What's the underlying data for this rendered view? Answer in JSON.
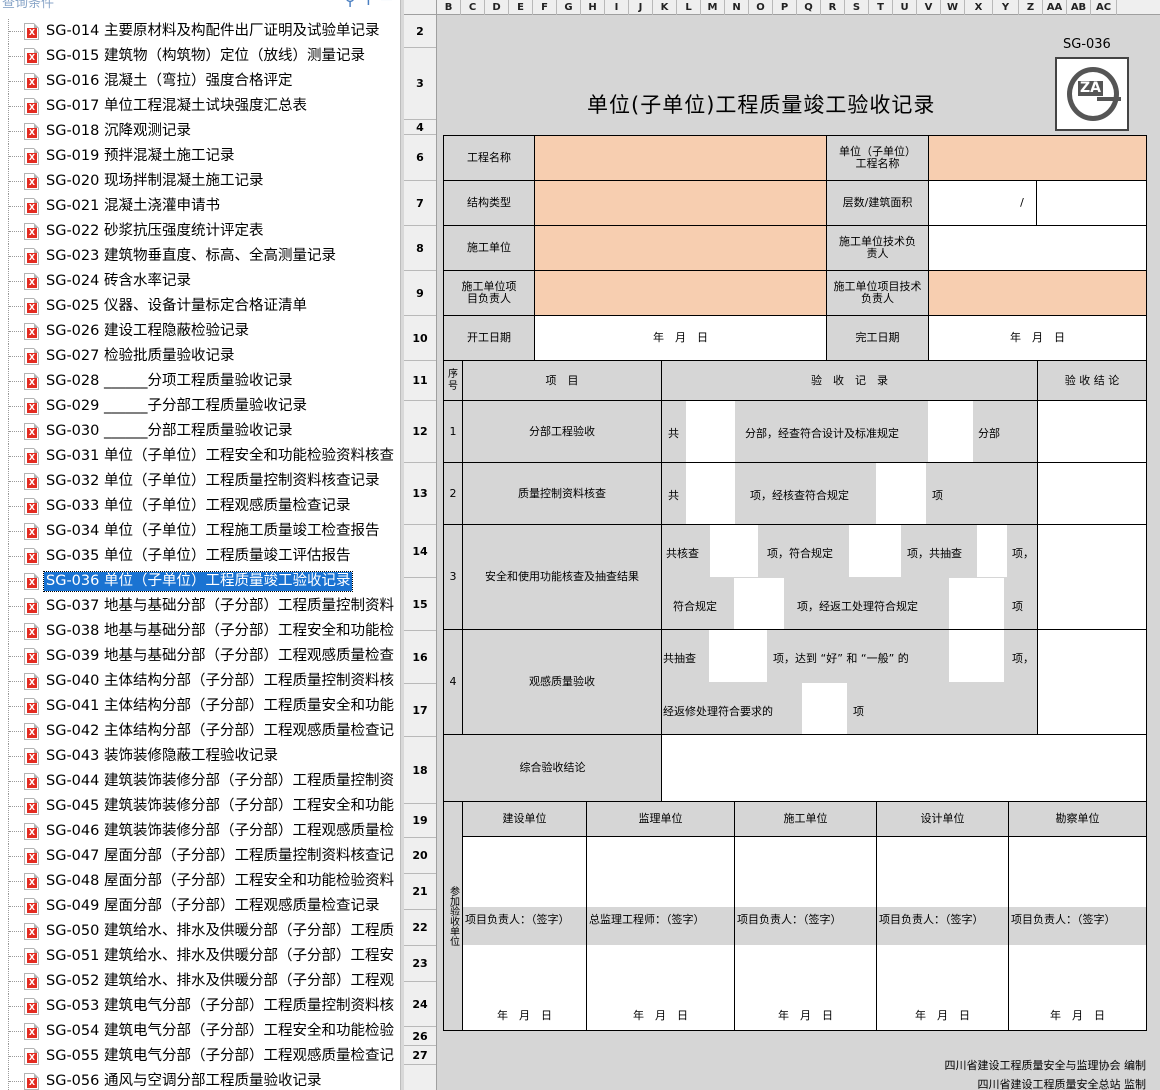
{
  "tree": {
    "search_text": "查询条件",
    "items": [
      "SG-014 主要原材料及构配件出厂证明及试验单记录",
      "SG-015 建筑物（构筑物）定位（放线）测量记录",
      "SG-016 混凝土（弯拉）强度合格评定",
      "SG-017 单位工程混凝土试块强度汇总表",
      "SG-018 沉降观测记录",
      "SG-019 预拌混凝土施工记录",
      "SG-020 现场拌制混凝土施工记录",
      "SG-021 混凝土浇灌申请书",
      "SG-022 砂浆抗压强度统计评定表",
      "SG-023 建筑物垂直度、标高、全高测量记录",
      "SG-024 砖含水率记录",
      "SG-025 仪器、设备计量标定合格证清单",
      "SG-026 建设工程隐蔽检验记录",
      "SG-027 检验批质量验收记录",
      "SG-028 ______分项工程质量验收记录",
      "SG-029 ______子分部工程质量验收记录",
      "SG-030 ______分部工程质量验收记录",
      "SG-031 单位（子单位）工程安全和功能检验资料核查",
      "SG-032 单位（子单位）工程质量控制资料核查记录",
      "SG-033 单位（子单位）工程观感质量检查记录",
      "SG-034 单位（子单位）工程施工质量竣工检查报告",
      "SG-035 单位（子单位）工程质量竣工评估报告",
      "SG-036 单位（子单位）工程质量竣工验收记录",
      "SG-037 地基与基础分部（子分部）工程质量控制资料",
      "SG-038 地基与基础分部（子分部）工程安全和功能检",
      "SG-039 地基与基础分部（子分部）工程观感质量检查",
      "SG-040 主体结构分部（子分部）工程质量控制资料核",
      "SG-041 主体结构分部（子分部）工程质量安全和功能",
      "SG-042 主体结构分部（子分部）工程观感质量检查记",
      "SG-043 装饰装修隐蔽工程验收记录",
      "SG-044 建筑装饰装修分部（子分部）工程质量控制资",
      "SG-045 建筑装饰装修分部（子分部）工程安全和功能",
      "SG-046 建筑装饰装修分部（子分部）工程观感质量检",
      "SG-047 屋面分部（子分部）工程质量控制资料核查记",
      "SG-048 屋面分部（子分部）工程安全和功能检验资料",
      "SG-049 屋面分部（子分部）工程观感质量检查记录",
      "SG-050 建筑给水、排水及供暖分部（子分部）工程质",
      "SG-051 建筑给水、排水及供暖分部（子分部）工程安",
      "SG-052 建筑给水、排水及供暖分部（子分部）工程观",
      "SG-053 建筑电气分部（子分部）工程质量控制资料核",
      "SG-054 建筑电气分部（子分部）工程安全和功能检验",
      "SG-055 建筑电气分部（子分部）工程观感质量检查记",
      "SG-056 通风与空调分部工程质量验收记录"
    ],
    "selected_index": 22
  },
  "sheet": {
    "columns": [
      "B",
      "C",
      "D",
      "E",
      "F",
      "G",
      "H",
      "I",
      "J",
      "K",
      "L",
      "M",
      "N",
      "O",
      "P",
      "Q",
      "R",
      "S",
      "T",
      "U",
      "V",
      "W",
      "X",
      "Y",
      "Z",
      "AA",
      "AB",
      "AC"
    ],
    "rows": [
      "2",
      "3",
      "4",
      "6",
      "7",
      "8",
      "9",
      "10",
      "11",
      "12",
      "13",
      "14",
      "15",
      "16",
      "17",
      "18",
      "19",
      "20",
      "21",
      "22",
      "23",
      "24",
      "26",
      "27"
    ],
    "code": "SG-036",
    "title": "单位(子单位)工程质量竣工验收记录",
    "logo_text": "ZA",
    "labels": {
      "project_name": "工程名称",
      "unit_project_name": "单位（子单位）工程名称",
      "structure_type": "结构类型",
      "floors_area": "层数/建筑面积",
      "slash": "/",
      "contractor": "施工单位",
      "contractor_tech": "施工单位技术负责人",
      "contractor_pm": "施工单位项目负责人",
      "contractor_pm_tech": "施工单位项目技术负责人",
      "start_date": "开工日期",
      "finish_date": "完工日期",
      "date": "年　月　日",
      "seq": "序号",
      "item": "项　目",
      "record": "验　收　记　录",
      "conclusion": "验 收 结 论"
    },
    "items": [
      {
        "no": "1",
        "name": "分部工程验收",
        "a": "共",
        "b": "分部，经查符合设计及标准规定",
        "c": "分部"
      },
      {
        "no": "2",
        "name": "质量控制资料核查",
        "a": "共",
        "b": "项，经核查符合规定",
        "c": "项"
      },
      {
        "no": "3",
        "name": "安全和使用功能核查及抽查结果",
        "a": "共核查",
        "b": "项，符合规定",
        "c": "项，共抽查",
        "d": "项，",
        "e": "符合规定",
        "f": "项，经返工处理符合规定",
        "g": "项"
      },
      {
        "no": "4",
        "name": "观感质量验收",
        "a": "共抽查",
        "b": "项，达到 “好” 和 “一般” 的",
        "c": "项，",
        "d": "经返修处理符合要求的",
        "e": "项"
      }
    ],
    "overall": "综合验收结论",
    "participants_label": "参加验收单位",
    "units": [
      {
        "name": "建设单位",
        "sign": "项目负责人：（签字）"
      },
      {
        "name": "监理单位",
        "sign": "总监理工程师：（签字）"
      },
      {
        "name": "施工单位",
        "sign": "项目负责人：（签字）"
      },
      {
        "name": "设计单位",
        "sign": "项目负责人：（签字）"
      },
      {
        "name": "勘察单位",
        "sign": "项目负责人：（签字）"
      }
    ],
    "footer1": "四川省建设工程质量安全与监理协会 编制",
    "footer2": "四川省建设工程质量安全总站 监制"
  }
}
